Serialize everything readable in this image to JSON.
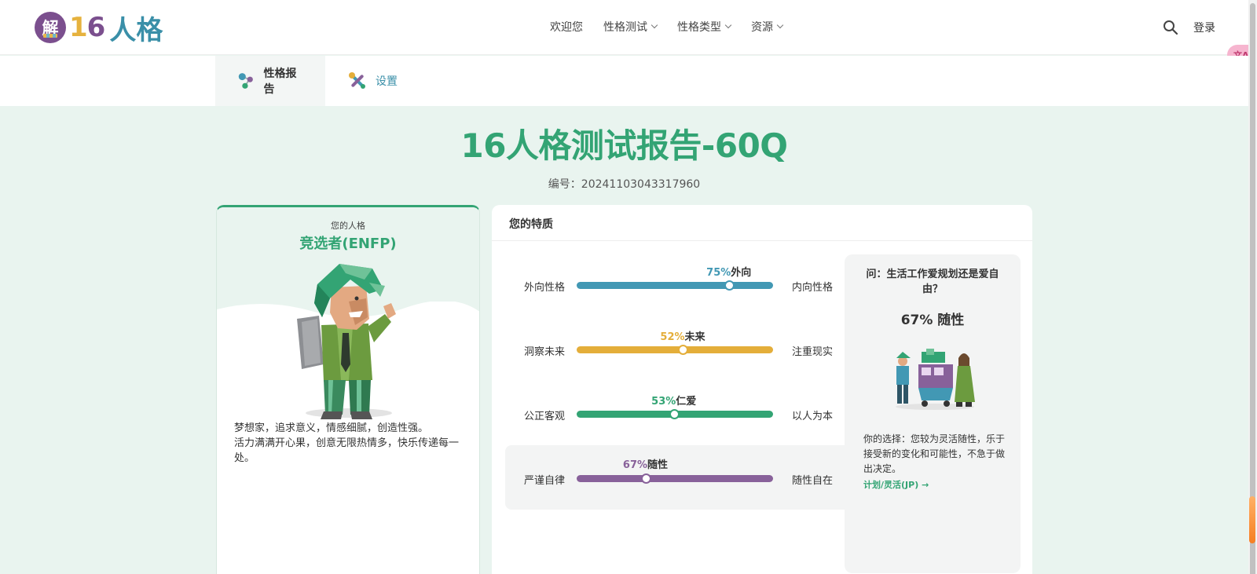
{
  "header": {
    "logo_badge": "解",
    "logo_number_1": "1",
    "logo_number_2": "6",
    "logo_text": "人格",
    "nav": [
      "欢迎您",
      "性格测试",
      "性格类型",
      "资源"
    ],
    "login": "登录",
    "translate_badge": "文A"
  },
  "tabs": {
    "report": "性格报告",
    "settings": "设置"
  },
  "page": {
    "title": "16人格测试报告-60Q",
    "report_id": "编号：20241103043317960"
  },
  "persona": {
    "label": "您的人格",
    "name": "竞选者(ENFP)",
    "description_1": "梦想家，追求意义，情感细腻，创造性强。",
    "description_2": "活力满满开心果，创意无限热情多，快乐传递每一处。"
  },
  "traits": {
    "title": "您的特质",
    "items": [
      {
        "left": "外向性格",
        "right": "内向性格",
        "percent": "75%",
        "label": "外向",
        "value": 75,
        "knob": 77.5,
        "color": "#4298b4"
      },
      {
        "left": "洞察未来",
        "right": "注重现实",
        "percent": "52%",
        "label": "未来",
        "value": 52,
        "knob": 54,
        "color": "#e4ae3a"
      },
      {
        "left": "公正客观",
        "right": "以人为本",
        "percent": "53%",
        "label": "仁爱",
        "value": 53,
        "knob": 49.5,
        "color": "#33a474"
      },
      {
        "left": "严谨自律",
        "right": "随性自在",
        "percent": "67%",
        "label": "随性",
        "value": 67,
        "knob": 35,
        "color": "#88619a"
      }
    ]
  },
  "qa": {
    "question": "问：生活工作爱规划还是爱自由？",
    "result": "67% 随性",
    "answer": "你的选择：您较为灵活随性，乐于接受新的变化和可能性，不急于做出决定。",
    "link": "计划/灵活(JP)"
  }
}
